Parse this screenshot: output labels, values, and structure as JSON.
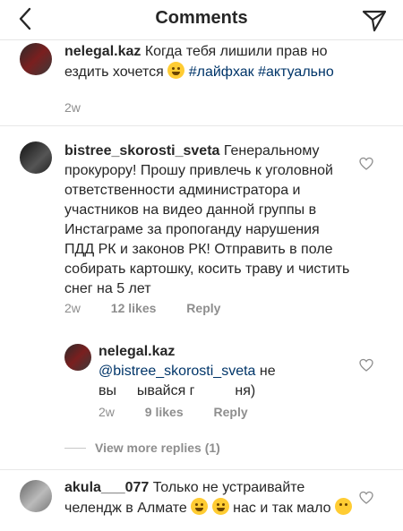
{
  "header": {
    "title": "Comments",
    "back_icon": "chevron-left-icon",
    "send_icon": "paper-plane-icon"
  },
  "comments": [
    {
      "user": "nelegal.kaz",
      "text": "Когда тебя лишили прав но ездить хочется",
      "tags": [
        "#лайфхак",
        "#актуально"
      ],
      "time": "2w"
    },
    {
      "user": "bistree_skorosti_sveta",
      "text": "Генеральному прокурору! Прошу привлечь к уголовной ответственности администратора и участников на видео данной группы в Инстаграме за пропоганду нарушения ПДД РК и законов РК! Отправить в поле собирать картошку, косить траву и чистить снег на 5 лет",
      "time": "2w",
      "likes": "12 likes",
      "reply": "Reply"
    },
    {
      "user": "nelegal.kaz",
      "mention": "@bistree_skorosti_sveta",
      "text_a": "не",
      "text_b": "вы",
      "text_c": "ывайся г",
      "text_d": "ня)",
      "time": "2w",
      "likes": "9 likes",
      "reply": "Reply"
    },
    {
      "user": "akula___077",
      "text_a": "Только не устраивайте челендж в Алмате",
      "text_b": "нас и так мало",
      "time": "",
      "likes": ""
    }
  ],
  "view_more": "View more replies (1)",
  "colors": {
    "text": "#262626",
    "muted": "#8e8e8e",
    "link": "#003569",
    "divider": "#e8e8e8"
  }
}
